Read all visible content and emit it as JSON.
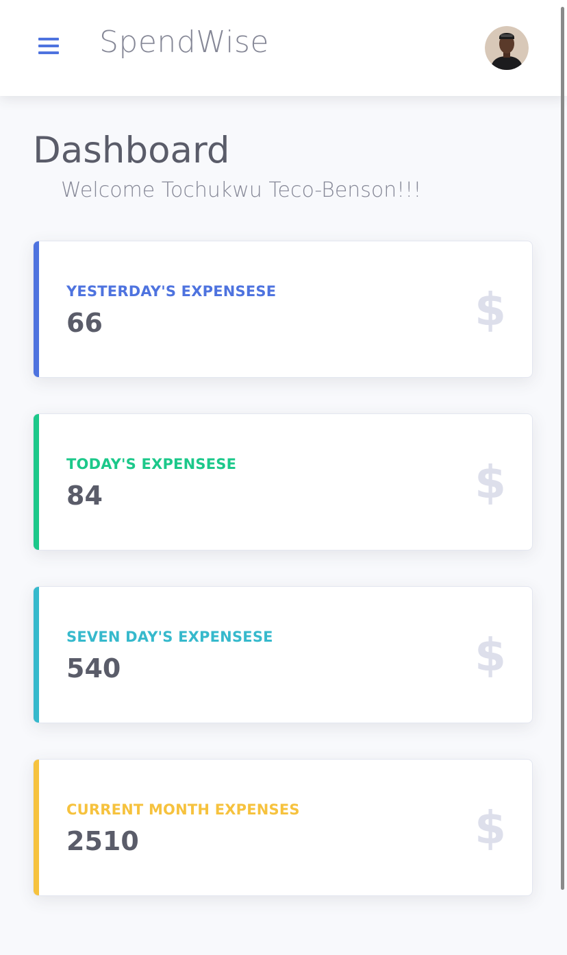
{
  "header": {
    "brand": "SpendWise",
    "menu_icon": "hamburger-menu-icon",
    "accent_color": "#4e73df"
  },
  "page": {
    "title": "Dashboard",
    "welcome": "Welcome Tochukwu Teco-Benson!!!"
  },
  "cards": [
    {
      "label": "YESTERDAY'S EXPENSESE",
      "value": "66",
      "color": "#4e73df",
      "icon": "dollar-icon",
      "symbol": "$"
    },
    {
      "label": "TODAY'S EXPENSESE",
      "value": "84",
      "color": "#1cc88a",
      "icon": "dollar-icon",
      "symbol": "$"
    },
    {
      "label": "SEVEN DAY'S EXPENSESE",
      "value": "540",
      "color": "#36b9cc",
      "icon": "dollar-icon",
      "symbol": "$"
    },
    {
      "label": "CURRENT MONTH EXPENSES",
      "value": "2510",
      "color": "#f6c23e",
      "icon": "dollar-icon",
      "symbol": "$"
    }
  ]
}
